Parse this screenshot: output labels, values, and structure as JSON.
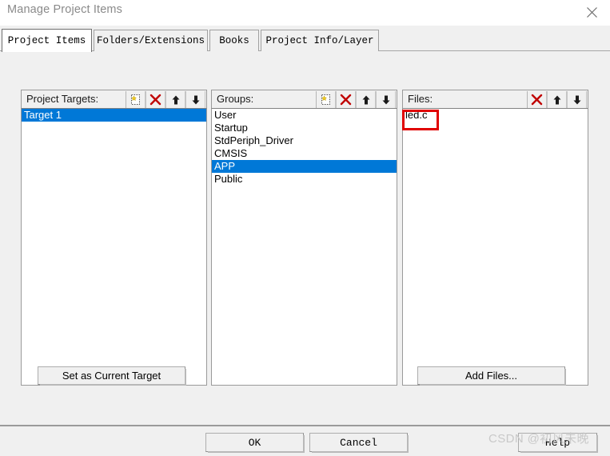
{
  "window": {
    "title": "Manage Project Items",
    "close_icon": "close-icon"
  },
  "tabs": [
    {
      "label": "Project Items",
      "active": true
    },
    {
      "label": "Folders/Extensions",
      "active": false
    },
    {
      "label": "Books",
      "active": false
    },
    {
      "label": "Project Info/Layer",
      "active": false
    }
  ],
  "panels": {
    "targets": {
      "label": "Project Targets:",
      "tools": [
        "new-item-icon",
        "delete-icon",
        "move-up-icon",
        "move-down-icon"
      ],
      "items": [
        {
          "label": "Target 1",
          "selected": true
        }
      ]
    },
    "groups": {
      "label": "Groups:",
      "tools": [
        "new-item-icon",
        "delete-icon",
        "move-up-icon",
        "move-down-icon"
      ],
      "items": [
        {
          "label": "User",
          "selected": false
        },
        {
          "label": "Startup",
          "selected": false
        },
        {
          "label": "StdPeriph_Driver",
          "selected": false
        },
        {
          "label": "CMSIS",
          "selected": false
        },
        {
          "label": "APP",
          "selected": true
        },
        {
          "label": "Public",
          "selected": false
        }
      ]
    },
    "files": {
      "label": "Files:",
      "tools": [
        "delete-icon",
        "move-up-icon",
        "move-down-icon"
      ],
      "items": [
        {
          "label": "led.c",
          "selected": false
        }
      ]
    }
  },
  "buttons": {
    "set_current_target": "Set as Current Target",
    "add_files": "Add Files...",
    "ok": "OK",
    "cancel": "Cancel",
    "help": "Help"
  },
  "annotation": {
    "watermark": "CSDN @初风未晚",
    "highlight_color": "#e00000"
  },
  "colors": {
    "selection": "#0078d7",
    "dialog_bg": "#f0f0f0",
    "list_bg": "#ffffff",
    "title_text": "#8a8a8a"
  }
}
